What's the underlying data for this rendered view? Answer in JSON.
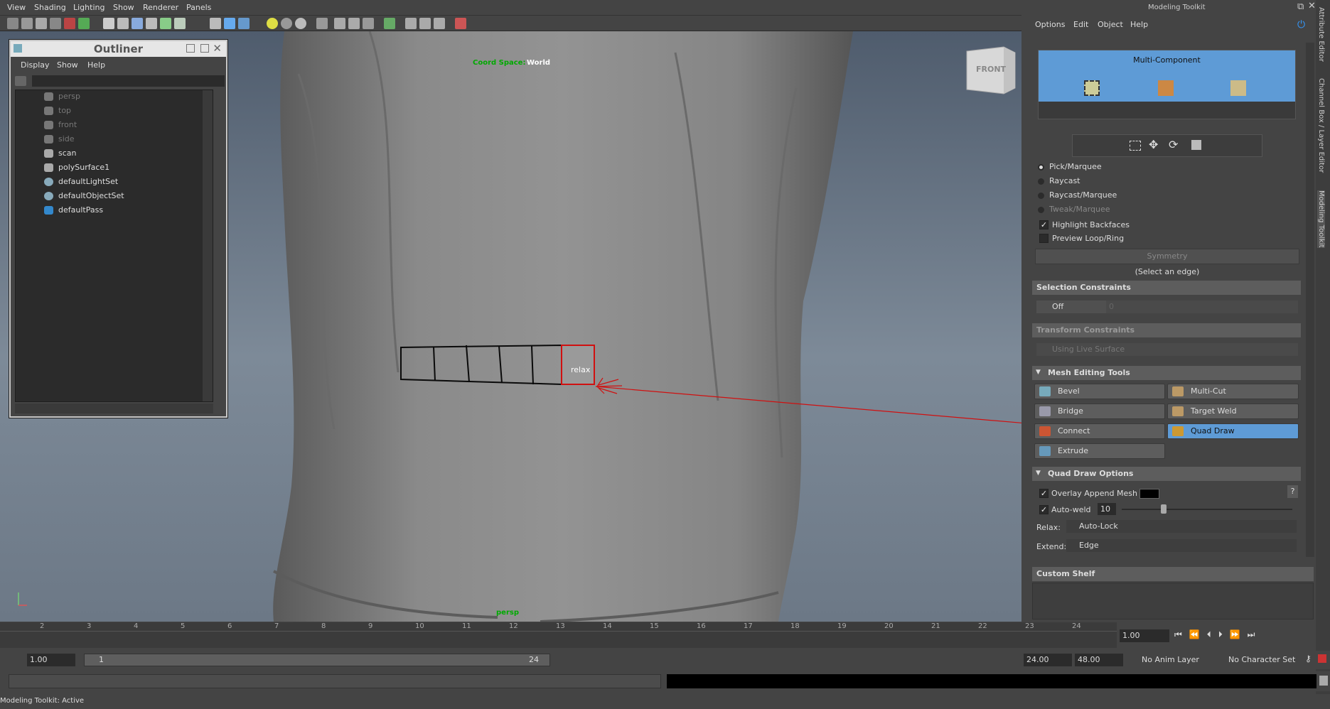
{
  "menubar": [
    "View",
    "Shading",
    "Lighting",
    "Show",
    "Renderer",
    "Panels"
  ],
  "viewport": {
    "coord_label": "Coord Space:",
    "coord_value": "World",
    "camera": "persp",
    "viewcube_label": "FRONT",
    "cursor_label": "relax",
    "accent_red": "#d01010"
  },
  "outliner": {
    "title": "Outliner",
    "menu": [
      "Display",
      "Show",
      "Help"
    ],
    "items": [
      {
        "label": "persp",
        "dim": true,
        "icon": "camera-icon"
      },
      {
        "label": "top",
        "dim": true,
        "icon": "camera-icon"
      },
      {
        "label": "front",
        "dim": true,
        "icon": "camera-icon"
      },
      {
        "label": "side",
        "dim": true,
        "icon": "camera-icon"
      },
      {
        "label": "scan",
        "dim": false,
        "icon": "mesh-icon"
      },
      {
        "label": "polySurface1",
        "dim": false,
        "icon": "mesh-icon"
      },
      {
        "label": "defaultLightSet",
        "dim": false,
        "icon": "set-icon"
      },
      {
        "label": "defaultObjectSet",
        "dim": false,
        "icon": "set-icon"
      },
      {
        "label": "defaultPass",
        "dim": false,
        "icon": "pass-icon"
      }
    ]
  },
  "toolkit": {
    "title": "Modeling Toolkit",
    "menu": [
      "Options",
      "Edit",
      "Object",
      "Help"
    ],
    "multi_component": "Multi-Component",
    "modes": [
      "Pick/Marquee",
      "Raycast",
      "Raycast/Marquee",
      "Tweak/Marquee"
    ],
    "highlight_backfaces": "Highlight Backfaces",
    "preview_loop": "Preview Loop/Ring",
    "symmetry": "Symmetry",
    "select_edge": "(Select an edge)",
    "selection_constraints": "Selection Constraints",
    "sel_off": "Off",
    "sel_val": "0",
    "transform_constraints": "Transform Constraints",
    "using_live": "Using Live Surface",
    "mesh_editing": "Mesh Editing Tools",
    "tools": {
      "bevel": "Bevel",
      "multicut": "Multi-Cut",
      "bridge": "Bridge",
      "targetweld": "Target Weld",
      "connect": "Connect",
      "quaddraw": "Quad Draw",
      "extrude": "Extrude"
    },
    "quad_draw_options": "Quad Draw Options",
    "overlay": "Overlay Append Mesh",
    "autoweld": "Auto-weld",
    "autoweld_val": "10",
    "relax_label": "Relax:",
    "relax_val": "Auto-Lock",
    "extend_label": "Extend:",
    "extend_val": "Edge",
    "custom_shelf": "Custom Shelf",
    "help_q": "?"
  },
  "side_tabs": [
    "Attribute Editor",
    "Channel Box / Layer Editor",
    "Modeling Toolkit"
  ],
  "timeline": {
    "ticks": [
      "2",
      "3",
      "4",
      "5",
      "6",
      "7",
      "8",
      "9",
      "10",
      "11",
      "12",
      "13",
      "14",
      "15",
      "16",
      "17",
      "18",
      "19",
      "20",
      "21",
      "22",
      "23",
      "24"
    ],
    "current": "1.00"
  },
  "range": {
    "start": "1.00",
    "slider_start": "1",
    "slider_end": "24",
    "end1": "24.00",
    "end2": "48.00",
    "anim_layer": "No Anim Layer",
    "char_set": "No Character Set"
  },
  "status": "Modeling Toolkit: Active"
}
